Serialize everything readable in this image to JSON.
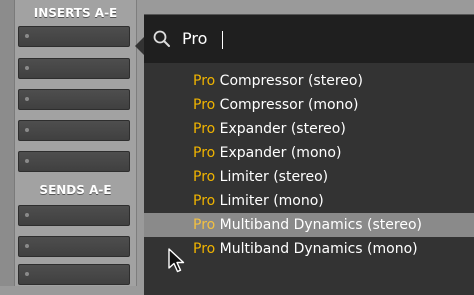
{
  "mixer": {
    "inserts_label": "INSERTS A-E",
    "sends_label": "SENDS A-E"
  },
  "search": {
    "icon": "search-icon",
    "query": "Pro"
  },
  "results": [
    {
      "match": "Pro",
      "rest": " Compressor (stereo)"
    },
    {
      "match": "Pro",
      "rest": " Compressor (mono)"
    },
    {
      "match": "Pro",
      "rest": " Expander (stereo)"
    },
    {
      "match": "Pro",
      "rest": " Expander (mono)"
    },
    {
      "match": "Pro",
      "rest": " Limiter (stereo)"
    },
    {
      "match": "Pro",
      "rest": " Limiter (mono)"
    },
    {
      "match": "Pro",
      "rest": " Multiband Dynamics (stereo)"
    },
    {
      "match": "Pro",
      "rest": " Multiband Dynamics (mono)"
    }
  ],
  "selected_index": 6,
  "colors": {
    "match_highlight": "#f0b400",
    "popup_bg": "#333333",
    "search_bg": "#1f1f1f",
    "selected_row": "#8a8a8a"
  }
}
